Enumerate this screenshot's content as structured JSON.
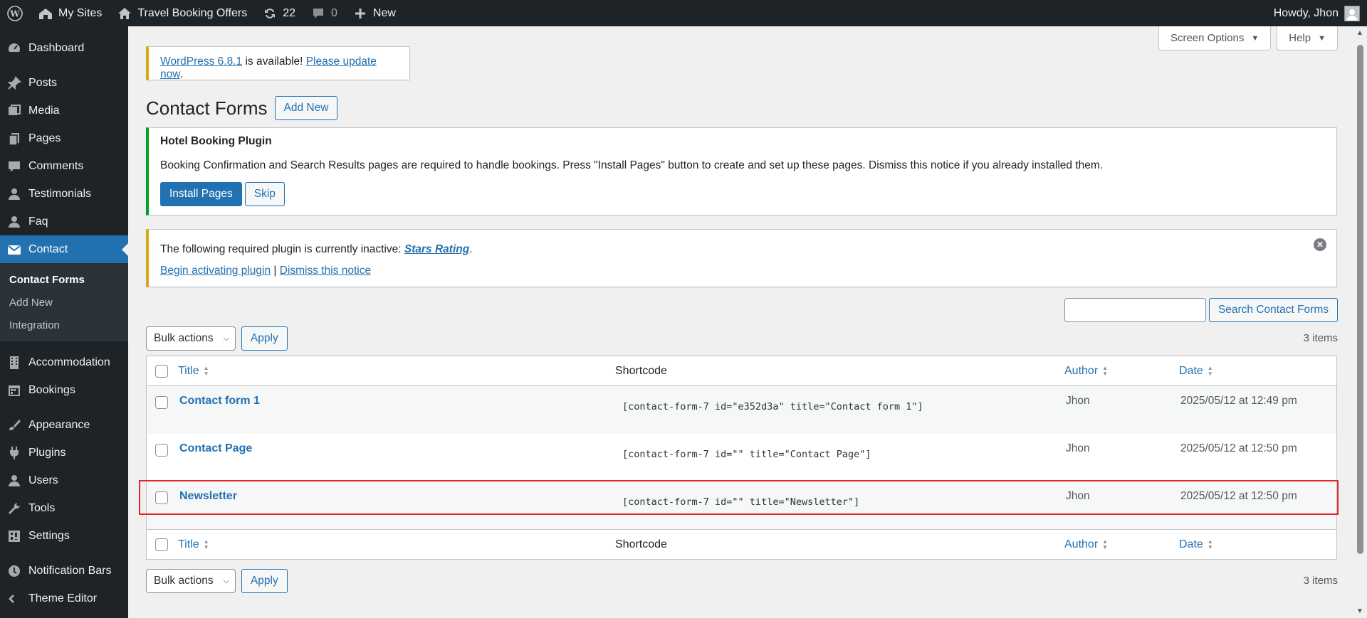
{
  "adminbar": {
    "my_sites": "My Sites",
    "site_name": "Travel Booking Offers",
    "updates_count": "22",
    "comments_count": "0",
    "new_label": "New",
    "howdy": "Howdy, Jhon"
  },
  "sidebar": {
    "items": [
      {
        "label": "Dashboard",
        "icon": "dashboard-icon"
      },
      {
        "label": "Posts",
        "icon": "pin-icon"
      },
      {
        "label": "Media",
        "icon": "media-icon"
      },
      {
        "label": "Pages",
        "icon": "pages-icon"
      },
      {
        "label": "Comments",
        "icon": "comment-icon"
      },
      {
        "label": "Testimonials",
        "icon": "user-icon"
      },
      {
        "label": "Faq",
        "icon": "user-icon"
      },
      {
        "label": "Contact",
        "icon": "mail-icon"
      },
      {
        "label": "Accommodation",
        "icon": "building-icon"
      },
      {
        "label": "Bookings",
        "icon": "calendar-icon"
      },
      {
        "label": "Appearance",
        "icon": "brush-icon"
      },
      {
        "label": "Plugins",
        "icon": "plugin-icon"
      },
      {
        "label": "Users",
        "icon": "user-icon"
      },
      {
        "label": "Tools",
        "icon": "wrench-icon"
      },
      {
        "label": "Settings",
        "icon": "settings-icon"
      },
      {
        "label": "Notification Bars",
        "icon": "notification-icon"
      },
      {
        "label": "Theme Editor",
        "icon": "code-icon"
      }
    ],
    "submenu": [
      "Contact Forms",
      "Add New",
      "Integration"
    ]
  },
  "screen_options": "Screen Options",
  "help": "Help",
  "update_nag": {
    "version_link": "WordPress 6.8.1",
    "middle": " is available! ",
    "update_link": "Please update now",
    "end": "."
  },
  "page_title": "Contact Forms",
  "add_new": "Add New",
  "hotel_notice": {
    "title": "Hotel Booking Plugin",
    "text": "Booking Confirmation and Search Results pages are required to handle bookings. Press \"Install Pages\" button to create and set up these pages. Dismiss this notice if you already installed them.",
    "install": "Install Pages",
    "skip": "Skip"
  },
  "plugin_notice": {
    "text": "The following required plugin is currently inactive: ",
    "plugin": "Stars Rating",
    "period": ".",
    "activate": "Begin activating plugin",
    "sep": " | ",
    "dismiss": "Dismiss this notice"
  },
  "search_button": "Search Contact Forms",
  "bulk_actions": "Bulk actions",
  "apply": "Apply",
  "items_count": "3 items",
  "columns": {
    "title": "Title",
    "shortcode": "Shortcode",
    "author": "Author",
    "date": "Date"
  },
  "rows": [
    {
      "title": "Contact form 1",
      "shortcode": "[contact-form-7 id=\"e352d3a\" title=\"Contact form 1\"]",
      "author": "Jhon",
      "date": "2025/05/12 at 12:49 pm"
    },
    {
      "title": "Contact Page",
      "shortcode": "[contact-form-7 id=\"\" title=\"Contact Page\"]",
      "author": "Jhon",
      "date": "2025/05/12 at 12:50 pm"
    },
    {
      "title": "Newsletter",
      "shortcode": "[contact-form-7 id=\"\" title=\"Newsletter\"]",
      "author": "Jhon",
      "date": "2025/05/12 at 12:50 pm"
    }
  ]
}
